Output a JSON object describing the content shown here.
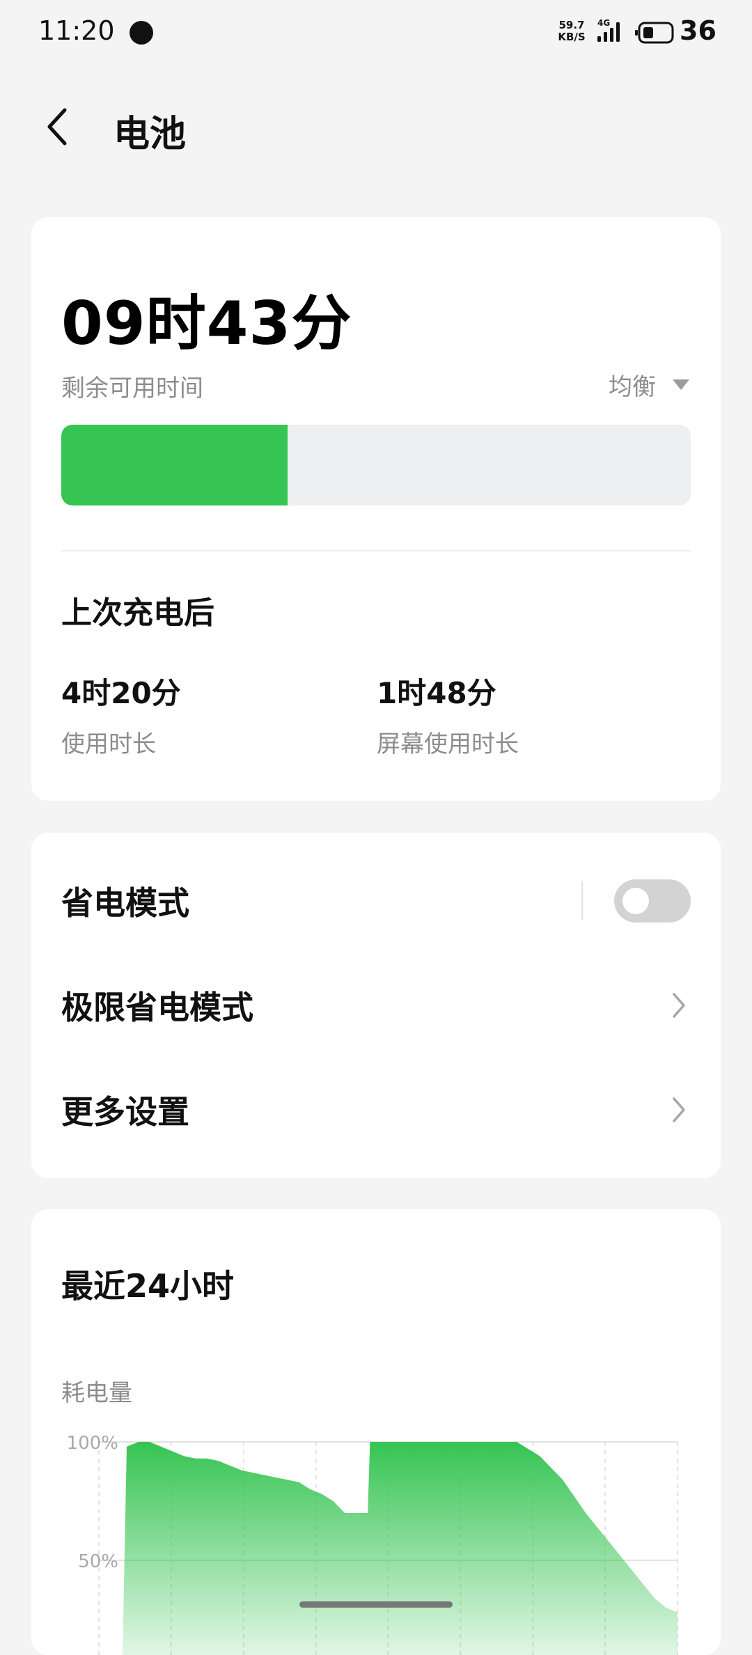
{
  "status_bar": {
    "time": "11:20",
    "net_speed_top": "59.7",
    "net_speed_bottom": "KB/S",
    "network_type": "4G",
    "battery_level": "36",
    "icons": [
      "notification-dot-icon",
      "signal-icon",
      "battery-icon"
    ]
  },
  "header": {
    "title": "电池",
    "back_icon": "chevron-left-icon"
  },
  "battery_summary": {
    "remaining_time": "09时43分",
    "remaining_label": "剩余可用时间",
    "mode_label": "均衡",
    "level_fraction": 0.36,
    "accent_color": "#36c452"
  },
  "since_charge": {
    "title": "上次充电后",
    "usage_value": "4时20分",
    "usage_label": "使用时长",
    "screen_value": "1时48分",
    "screen_label": "屏幕使用时长"
  },
  "settings": {
    "power_saving": {
      "label": "省电模式",
      "enabled": false
    },
    "ultra_power_saving": {
      "label": "极限省电模式"
    },
    "more_settings": {
      "label": "更多设置"
    }
  },
  "recent": {
    "title": "最近24小时",
    "subtitle": "耗电量"
  },
  "chart_data": {
    "type": "area",
    "ytick_labels": [
      "100%",
      "50%"
    ],
    "yticks": [
      100,
      50
    ],
    "ylim": [
      0,
      100
    ],
    "x": [
      0,
      0.5,
      1,
      1.5,
      2,
      2.5,
      3,
      3.5,
      4,
      4.5,
      5,
      5.5,
      6,
      6.5,
      7,
      7.5,
      8,
      8.5,
      9,
      9.5,
      10,
      10.5,
      10.6,
      11,
      11.5,
      12,
      12.5,
      13,
      13.5,
      14,
      14.5,
      15,
      15.5,
      16,
      16.5,
      17,
      17.5,
      18,
      18.5,
      19,
      19.5,
      20,
      20.5,
      21,
      21.5,
      22,
      22.5,
      23,
      23.5,
      24
    ],
    "values": [
      98,
      100,
      100,
      98,
      96,
      94,
      93,
      93,
      92,
      90,
      88,
      87,
      86,
      85,
      84,
      83,
      80,
      78,
      75,
      70,
      70,
      70,
      100,
      100,
      100,
      100,
      100,
      100,
      100,
      100,
      100,
      100,
      100,
      100,
      100,
      100,
      97,
      94,
      89,
      84,
      77,
      70,
      64,
      58,
      52,
      46,
      40,
      34,
      30,
      28
    ],
    "color": "#36c452",
    "grid": true,
    "legend": "none"
  },
  "home_indicator": {
    "visible": true
  }
}
